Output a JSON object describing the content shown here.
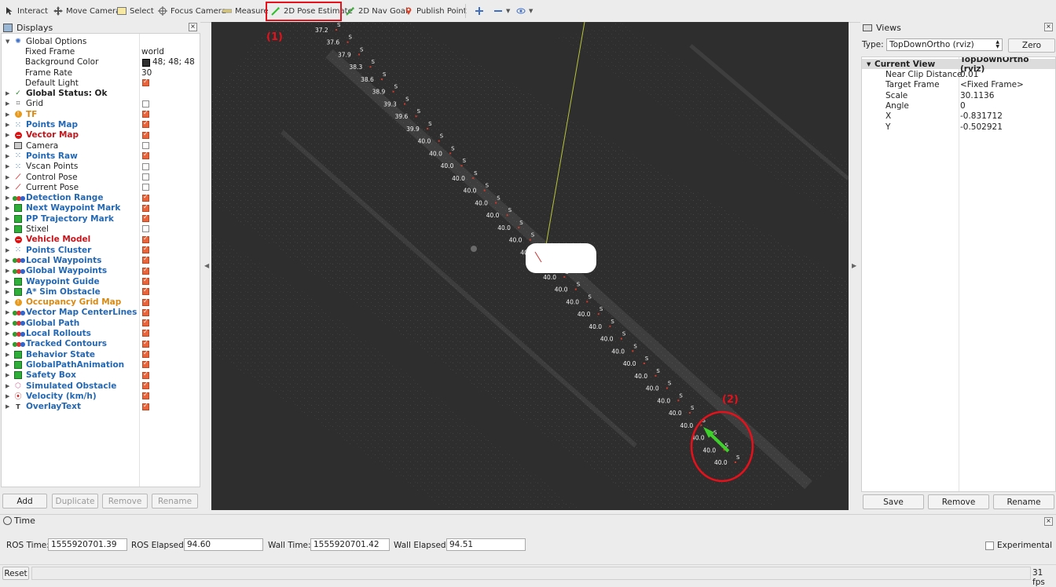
{
  "toolbar": {
    "interact": "Interact",
    "move_camera": "Move Camera",
    "select": "Select",
    "focus_camera": "Focus Camera",
    "measure": "Measure",
    "pose_estimate": "2D Pose Estimate",
    "nav_goal": "2D Nav Goal",
    "publish_point": "Publish Point"
  },
  "displays": {
    "title": "Displays",
    "rows": [
      {
        "label": "Global Options",
        "value": "",
        "cb": null,
        "style": "",
        "icon": "gear",
        "indent": 0
      },
      {
        "label": "Fixed Frame",
        "value": "world",
        "cb": null,
        "style": "",
        "icon": "",
        "indent": 1
      },
      {
        "label": "Background Color",
        "value": "48; 48; 48",
        "cb": null,
        "style": "",
        "icon": "",
        "indent": 1,
        "swatch": true
      },
      {
        "label": "Frame Rate",
        "value": "30",
        "cb": null,
        "style": "",
        "icon": "",
        "indent": 1
      },
      {
        "label": "Default Light",
        "value": "",
        "cb": true,
        "style": "",
        "icon": "",
        "indent": 1
      },
      {
        "label": "Global Status: Ok",
        "value": "",
        "cb": null,
        "style": "bold",
        "icon": "check",
        "indent": 0
      },
      {
        "label": "Grid",
        "value": "",
        "cb": false,
        "style": "",
        "icon": "grid",
        "indent": 0
      },
      {
        "label": "TF",
        "value": "",
        "cb": true,
        "style": "orange",
        "icon": "warn",
        "indent": 0
      },
      {
        "label": "Points Map",
        "value": "",
        "cb": true,
        "style": "blue",
        "icon": "dots",
        "indent": 0
      },
      {
        "label": "Vector Map",
        "value": "",
        "cb": true,
        "style": "red",
        "icon": "stop",
        "indent": 0
      },
      {
        "label": "Camera",
        "value": "",
        "cb": false,
        "style": "",
        "icon": "camera",
        "indent": 0
      },
      {
        "label": "Points Raw",
        "value": "",
        "cb": true,
        "style": "blue",
        "icon": "dots",
        "indent": 0
      },
      {
        "label": "Vscan Points",
        "value": "",
        "cb": false,
        "style": "",
        "icon": "dots",
        "indent": 0
      },
      {
        "label": "Control Pose",
        "value": "",
        "cb": false,
        "style": "",
        "icon": "pose",
        "indent": 0
      },
      {
        "label": "Current Pose",
        "value": "",
        "cb": false,
        "style": "",
        "icon": "pose",
        "indent": 0
      },
      {
        "label": "Detection Range",
        "value": "",
        "cb": true,
        "style": "blue",
        "icon": "multi",
        "indent": 0
      },
      {
        "label": "Next Waypoint Mark",
        "value": "",
        "cb": true,
        "style": "blue",
        "icon": "cube",
        "indent": 0
      },
      {
        "label": "PP Trajectory Mark",
        "value": "",
        "cb": true,
        "style": "blue",
        "icon": "cube",
        "indent": 0
      },
      {
        "label": "Stixel",
        "value": "",
        "cb": false,
        "style": "",
        "icon": "cube",
        "indent": 0
      },
      {
        "label": "Vehicle Model",
        "value": "",
        "cb": true,
        "style": "red",
        "icon": "stop",
        "indent": 0
      },
      {
        "label": "Points Cluster",
        "value": "",
        "cb": true,
        "style": "blue",
        "icon": "dots",
        "indent": 0
      },
      {
        "label": "Local Waypoints",
        "value": "",
        "cb": true,
        "style": "blue",
        "icon": "multi",
        "indent": 0
      },
      {
        "label": "Global Waypoints",
        "value": "",
        "cb": true,
        "style": "blue",
        "icon": "multi",
        "indent": 0
      },
      {
        "label": "Waypoint Guide",
        "value": "",
        "cb": true,
        "style": "blue",
        "icon": "cube",
        "indent": 0
      },
      {
        "label": "A* Sim Obstacle",
        "value": "",
        "cb": true,
        "style": "blue",
        "icon": "cube",
        "indent": 0
      },
      {
        "label": "Occupancy Grid Map",
        "value": "",
        "cb": true,
        "style": "orange",
        "icon": "warn",
        "indent": 0
      },
      {
        "label": "Vector Map CenterLines",
        "value": "",
        "cb": true,
        "style": "blue",
        "icon": "multi",
        "indent": 0
      },
      {
        "label": "Global Path",
        "value": "",
        "cb": true,
        "style": "blue",
        "icon": "multi",
        "indent": 0
      },
      {
        "label": "Local Rollouts",
        "value": "",
        "cb": true,
        "style": "blue",
        "icon": "multi",
        "indent": 0
      },
      {
        "label": "Tracked Contours",
        "value": "",
        "cb": true,
        "style": "blue",
        "icon": "multi",
        "indent": 0
      },
      {
        "label": "Behavior State",
        "value": "",
        "cb": true,
        "style": "blue",
        "icon": "cube",
        "indent": 0
      },
      {
        "label": "GlobalPathAnimation",
        "value": "",
        "cb": true,
        "style": "blue",
        "icon": "cube",
        "indent": 0
      },
      {
        "label": "Safety Box",
        "value": "",
        "cb": true,
        "style": "blue",
        "icon": "cube",
        "indent": 0
      },
      {
        "label": "Simulated Obstacle",
        "value": "",
        "cb": true,
        "style": "blue",
        "icon": "poly",
        "indent": 0
      },
      {
        "label": "Velocity (km/h)",
        "value": "",
        "cb": true,
        "style": "blue",
        "icon": "chart",
        "indent": 0
      },
      {
        "label": "OverlayText",
        "value": "",
        "cb": true,
        "style": "blue",
        "icon": "text",
        "indent": 0
      }
    ],
    "buttons": {
      "add": "Add",
      "duplicate": "Duplicate",
      "remove": "Remove",
      "rename": "Rename"
    }
  },
  "viewport": {
    "annotation_1": "(1)",
    "annotation_2": "(2)",
    "speed_labels": [
      "37.2",
      "37.6",
      "37.9",
      "38.3",
      "38.6",
      "38.9",
      "39.3",
      "39.6",
      "39.9",
      "40.0",
      "40.0",
      "40.0",
      "40.0",
      "40.0",
      "40.0",
      "40.0",
      "40.0",
      "40.0",
      "40.0",
      "40.0",
      "40.0",
      "40.0",
      "40.0",
      "40.0",
      "40.0",
      "40.0",
      "40.0",
      "40.0",
      "40.0",
      "40.0",
      "40.0",
      "40.0",
      "40.0",
      "40.0",
      "40.0",
      "40.0"
    ],
    "marker_letter": "S"
  },
  "views": {
    "title": "Views",
    "type_label": "Type:",
    "type_value": "TopDownOrtho (rviz)",
    "zero": "Zero",
    "header_key": "Current View",
    "header_value": "TopDownOrtho (rviz)",
    "props": [
      {
        "k": "Near Clip Distance",
        "v": "0.01"
      },
      {
        "k": "Target Frame",
        "v": "<Fixed Frame>"
      },
      {
        "k": "Scale",
        "v": "30.1136"
      },
      {
        "k": "Angle",
        "v": "0"
      },
      {
        "k": "X",
        "v": "-0.831712"
      },
      {
        "k": "Y",
        "v": "-0.502921"
      }
    ],
    "buttons": {
      "save": "Save",
      "remove": "Remove",
      "rename": "Rename"
    }
  },
  "time": {
    "title": "Time",
    "ros_time_label": "ROS Time:",
    "ros_time": "1555920701.39",
    "ros_elapsed_label": "ROS Elapsed:",
    "ros_elapsed": "94.60",
    "wall_time_label": "Wall Time:",
    "wall_time": "1555920701.42",
    "wall_elapsed_label": "Wall Elapsed:",
    "wall_elapsed": "94.51",
    "experimental": "Experimental",
    "reset": "Reset",
    "fps": "31 fps"
  },
  "colors": {
    "viewport_bg": "#2e2e2e",
    "highlight": "#e8101a",
    "pose_arrow": "#3fd12b",
    "checkbox_on": "#e9643a"
  }
}
